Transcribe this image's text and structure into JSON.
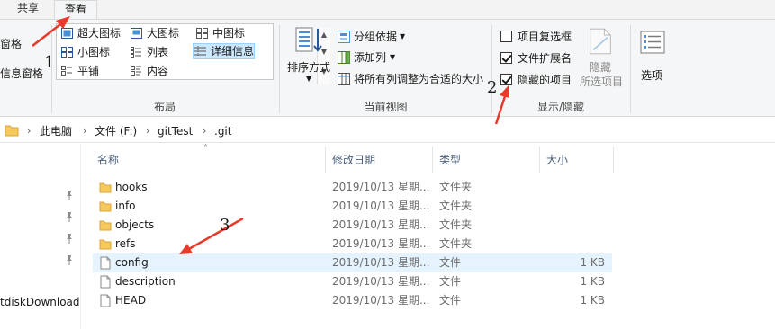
{
  "tabs": {
    "share": "共享",
    "view": "查看"
  },
  "ribbon": {
    "pane": {
      "partial_1": "窗格",
      "partial_2": "信息窗格"
    },
    "layout": {
      "group_label": "布局",
      "items": {
        "extra_large": "超大图标",
        "large": "大图标",
        "medium": "中图标",
        "small": "小图标",
        "list": "列表",
        "details": "详细信息",
        "tiles": "平铺",
        "content": "内容"
      },
      "selected": "详细信息"
    },
    "current_view": {
      "group_label": "当前视图",
      "sort_by": "排序方式",
      "group_by": "分组依据",
      "add_columns": "添加列",
      "size_all_columns": "将所有列调整为合适的大小"
    },
    "show_hide": {
      "group_label": "显示/隐藏",
      "item_checkboxes": {
        "label": "项目复选框",
        "checked": false
      },
      "file_extensions": {
        "label": "文件扩展名",
        "checked": true
      },
      "hidden_items": {
        "label": "隐藏的项目",
        "checked": true
      },
      "hide_selected_line1": "隐藏",
      "hide_selected_line2": "所选项目"
    },
    "options": "选项"
  },
  "address": {
    "crumbs": [
      "此电脑",
      "文件 (F:)",
      "gitTest",
      ".git"
    ]
  },
  "nav": {
    "partial_item": "tdiskDownload"
  },
  "columns": {
    "name": "名称",
    "modified": "修改日期",
    "type": "类型",
    "size": "大小"
  },
  "files": [
    {
      "name": "hooks",
      "modified": "2019/10/13 星期...",
      "type": "文件夹",
      "size": "",
      "kind": "folder"
    },
    {
      "name": "info",
      "modified": "2019/10/13 星期...",
      "type": "文件夹",
      "size": "",
      "kind": "folder"
    },
    {
      "name": "objects",
      "modified": "2019/10/13 星期...",
      "type": "文件夹",
      "size": "",
      "kind": "folder"
    },
    {
      "name": "refs",
      "modified": "2019/10/13 星期...",
      "type": "文件夹",
      "size": "",
      "kind": "folder"
    },
    {
      "name": "config",
      "modified": "2019/10/13 星期...",
      "type": "文件",
      "size": "1 KB",
      "kind": "file"
    },
    {
      "name": "description",
      "modified": "2019/10/13 星期...",
      "type": "文件",
      "size": "1 KB",
      "kind": "file"
    },
    {
      "name": "HEAD",
      "modified": "2019/10/13 星期...",
      "type": "文件",
      "size": "1 KB",
      "kind": "file"
    }
  ],
  "annotations": {
    "step1": "1",
    "step2": "2",
    "step3": "3"
  },
  "colors": {
    "accent_selection": "#cce8ff",
    "row_hover": "#e5f3ff",
    "folder": "#f6c95b",
    "annotation_arrow": "#e8392a"
  }
}
